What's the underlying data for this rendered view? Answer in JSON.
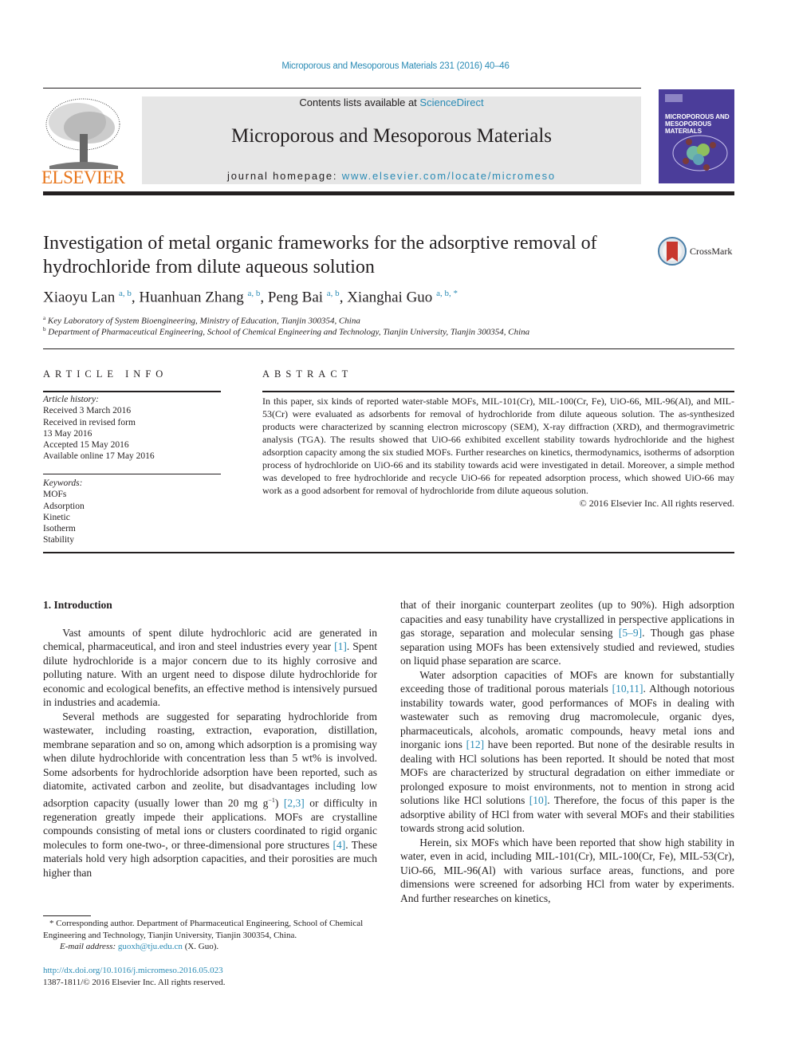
{
  "running_head": "Microporous and Mesoporous Materials 231 (2016) 40–46",
  "publisher": {
    "wordmark": "ELSEVIER",
    "logo_icon": "elsevier-tree-icon"
  },
  "masthead": {
    "contents_prefix": "Contents lists available at ",
    "contents_link": "ScienceDirect",
    "journal_title": "Microporous and Mesoporous Materials",
    "homepage_prefix": "journal homepage: ",
    "homepage_link": "www.elsevier.com/locate/micromeso"
  },
  "cover": {
    "title_line1": "MICROPOROUS AND",
    "title_line2": "MESOPOROUS MATERIALS"
  },
  "article": {
    "title": "Investigation of metal organic frameworks for the adsorptive removal of hydrochloride from dilute aqueous solution",
    "crossmark_label": "CrossMark",
    "authors": [
      {
        "name": "Xiaoyu Lan",
        "sup": "a, b"
      },
      {
        "name": "Huanhuan Zhang",
        "sup": "a, b"
      },
      {
        "name": "Peng Bai",
        "sup": "a, b"
      },
      {
        "name": "Xianghai Guo",
        "sup": "a, b, *"
      }
    ],
    "affiliations": [
      {
        "mark": "a",
        "text": "Key Laboratory of System Bioengineering, Ministry of Education, Tianjin 300354, China"
      },
      {
        "mark": "b",
        "text": "Department of Pharmaceutical Engineering, School of Chemical Engineering and Technology, Tianjin University, Tianjin 300354, China"
      }
    ]
  },
  "article_info": {
    "heading": "ARTICLE INFO",
    "history_label": "Article history:",
    "history": [
      "Received 3 March 2016",
      "Received in revised form",
      "13 May 2016",
      "Accepted 15 May 2016",
      "Available online 17 May 2016"
    ],
    "keywords_label": "Keywords:",
    "keywords": [
      "MOFs",
      "Adsorption",
      "Kinetic",
      "Isotherm",
      "Stability"
    ]
  },
  "abstract": {
    "heading": "ABSTRACT",
    "text": "In this paper, six kinds of reported water-stable MOFs, MIL-101(Cr), MIL-100(Cr, Fe), UiO-66, MIL-96(Al), and MIL-53(Cr) were evaluated as adsorbents for removal of hydrochloride from dilute aqueous solution. The as-synthesized products were characterized by scanning electron microscopy (SEM), X-ray diffraction (XRD), and thermogravimetric analysis (TGA). The results showed that UiO-66 exhibited excellent stability towards hydrochloride and the highest adsorption capacity among the six studied MOFs. Further researches on kinetics, thermodynamics, isotherms of adsorption process of hydrochloride on UiO-66 and its stability towards acid were investigated in detail. Moreover, a simple method was developed to free hydrochloride and recycle UiO-66 for repeated adsorption process, which showed UiO-66 may work as a good adsorbent for removal of hydrochloride from dilute aqueous solution.",
    "copyright": "© 2016 Elsevier Inc. All rights reserved."
  },
  "intro": {
    "heading": "1.  Introduction",
    "p1_a": "Vast amounts of spent dilute hydrochloric acid are generated in chemical, pharmaceutical, and iron and steel industries every year ",
    "p1_ref1": "[1]",
    "p1_b": ". Spent dilute hydrochloride is a major concern due to its highly corrosive and polluting nature. With an urgent need to dispose dilute hydrochloride for economic and ecological benefits, an effective method is intensively pursued in industries and academia.",
    "p2_a": "Several methods are suggested for separating hydrochloride from wastewater, including roasting, extraction, evaporation, distillation, membrane separation and so on, among which adsorption is a promising way when dilute hydrochloride with concentration less than 5 wt% is involved. Some adsorbents for hydrochloride adsorption have been reported, such as diatomite, activated carbon and zeolite, but disadvantages including low adsorption capacity (usually lower than 20 mg g",
    "p2_sup": "−1",
    "p2_b": ") ",
    "p2_ref1": "[2,3]",
    "p2_c": " or difficulty in regeneration greatly impede their applications. MOFs are crystalline compounds consisting of metal ions or clusters coordinated to rigid organic molecules to form one-two-, or three-dimensional pore structures ",
    "p2_ref2": "[4]",
    "p2_d": ". These materials hold very high adsorption capacities, and their porosities are much higher than",
    "r1_a": "that of their inorganic counterpart zeolites (up to 90%). High adsorption capacities and easy tunability have crystallized in perspective applications in gas storage, separation and molecular sensing ",
    "r1_ref": "[5–9]",
    "r1_b": ". Though gas phase separation using MOFs has been extensively studied and reviewed, studies on liquid phase separation are scarce.",
    "r2_a": "Water adsorption capacities of MOFs are known for substantially exceeding those of traditional porous materials ",
    "r2_ref1": "[10,11]",
    "r2_b": ". Although notorious instability towards water, good performances of MOFs in dealing with wastewater such as removing drug macromolecule, organic dyes, pharmaceuticals, alcohols, aromatic compounds, heavy metal ions and inorganic ions ",
    "r2_ref2": "[12]",
    "r2_c": " have been reported. But none of the desirable results in dealing with HCl solutions has been reported. It should be noted that most MOFs are characterized by structural degradation on either immediate or prolonged exposure to moist environments, not to mention in strong acid solutions like HCl solutions ",
    "r2_ref3": "[10]",
    "r2_d": ". Therefore, the focus of this paper is the adsorptive ability of HCl from water with several MOFs and their stabilities towards strong acid solution.",
    "r3": "Herein, six MOFs which have been reported that show high stability in water, even in acid, including MIL-101(Cr), MIL-100(Cr, Fe), MIL-53(Cr), UiO-66, MIL-96(Al) with various surface areas, functions, and pore dimensions were screened for adsorbing HCl from water by experiments. And further researches on kinetics,"
  },
  "footnote": {
    "corresponding": "* Corresponding author. Department of Pharmaceutical Engineering, School of Chemical Engineering and Technology, Tianjin University, Tianjin 300354, China.",
    "email_label": "E-mail address: ",
    "email": "guoxh@tju.edu.cn",
    "email_suffix": " (X. Guo).",
    "doi": "http://dx.doi.org/10.1016/j.micromeso.2016.05.023",
    "issn_line": "1387-1811/© 2016 Elsevier Inc. All rights reserved."
  }
}
